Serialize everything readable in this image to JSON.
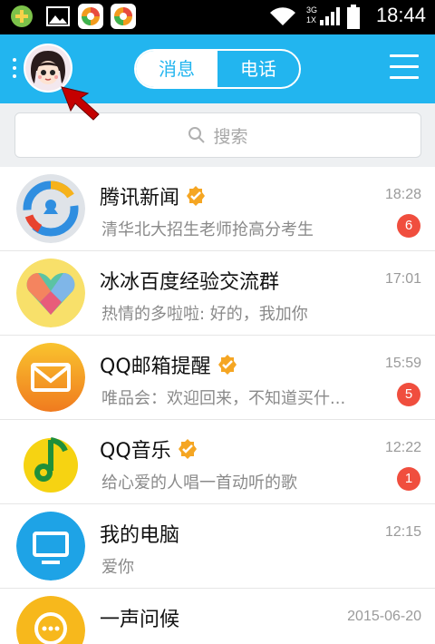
{
  "status_bar": {
    "time": "18:44",
    "network_top": "3G",
    "network_bottom": "1X",
    "icons": [
      "qq-plus-icon",
      "gallery-icon",
      "app-store-icon",
      "app-store-icon",
      "wifi-icon",
      "signal-icon",
      "battery-icon"
    ]
  },
  "header": {
    "tabs": [
      {
        "label": "消息",
        "active": true
      },
      {
        "label": "电话",
        "active": false
      }
    ]
  },
  "search": {
    "placeholder": "搜索"
  },
  "conversations": [
    {
      "name": "腾讯新闻",
      "verified": true,
      "preview": "清华北大招生老师抢高分考生",
      "time": "18:28",
      "unread": "6",
      "avatar": "tencent-news-icon"
    },
    {
      "name": "冰冰百度经验交流群",
      "verified": false,
      "preview": "热情的多啦啦: 好的，我加你",
      "time": "17:01",
      "unread": "",
      "avatar": "group-heart-icon"
    },
    {
      "name": "QQ邮箱提醒",
      "verified": true,
      "preview": "唯品会：欢迎回来，不知道买什...",
      "time": "15:59",
      "unread": "5",
      "avatar": "mail-icon"
    },
    {
      "name": "QQ音乐",
      "verified": true,
      "preview": "给心爱的人唱一首动听的歌",
      "time": "12:22",
      "unread": "1",
      "avatar": "music-note-icon"
    },
    {
      "name": "我的电脑",
      "verified": false,
      "preview": "爱你",
      "time": "12:15",
      "unread": "",
      "avatar": "monitor-icon"
    },
    {
      "name": "一声问候",
      "verified": false,
      "preview": "",
      "time": "2015-06-20",
      "unread": "",
      "avatar": "chat-bubble-icon"
    }
  ],
  "colors": {
    "accent": "#22b5ef",
    "badge": "#f04e3e",
    "verified": "#f5a623",
    "arrow": "#c40000"
  }
}
